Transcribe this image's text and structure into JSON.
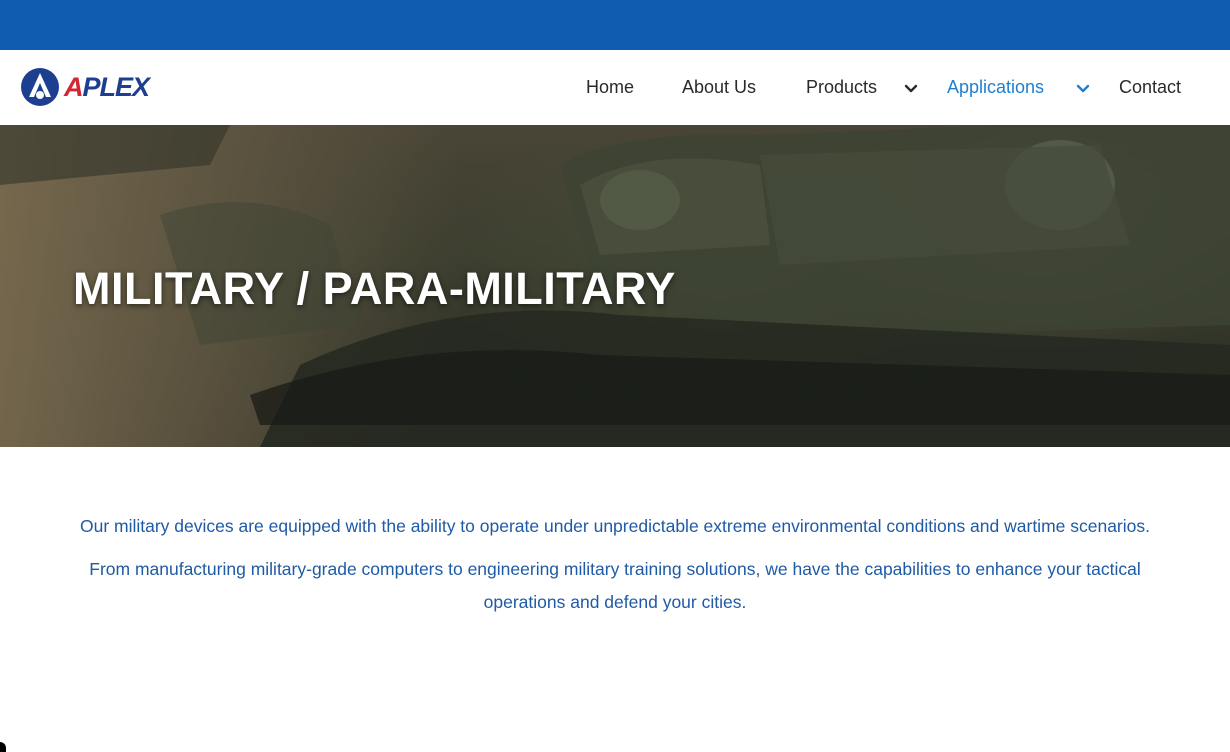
{
  "brand": {
    "logo_text_a": "A",
    "logo_text_rest": "PLEX",
    "colors": {
      "blue": "#1d3f8f",
      "red": "#d32632",
      "topbar": "#0f5bb0",
      "active_nav": "#1e7fd0"
    }
  },
  "nav": {
    "items": [
      {
        "label": "Home"
      },
      {
        "label": "About Us"
      },
      {
        "label": "Products",
        "icon": "chevron-down-icon"
      },
      {
        "label": "Applications",
        "icon": "chevron-down-icon",
        "active": true
      },
      {
        "label": "Contact"
      }
    ]
  },
  "hero": {
    "title": "MILITARY / PARA-MILITARY"
  },
  "content": {
    "paragraphs": [
      "Our military devices are equipped with the ability to operate under unpredictable extreme environmental conditions and wartime scenarios.",
      "From manufacturing military-grade computers to engineering military training solutions, we have the capabilities to enhance your tactical operations and defend your cities."
    ]
  }
}
